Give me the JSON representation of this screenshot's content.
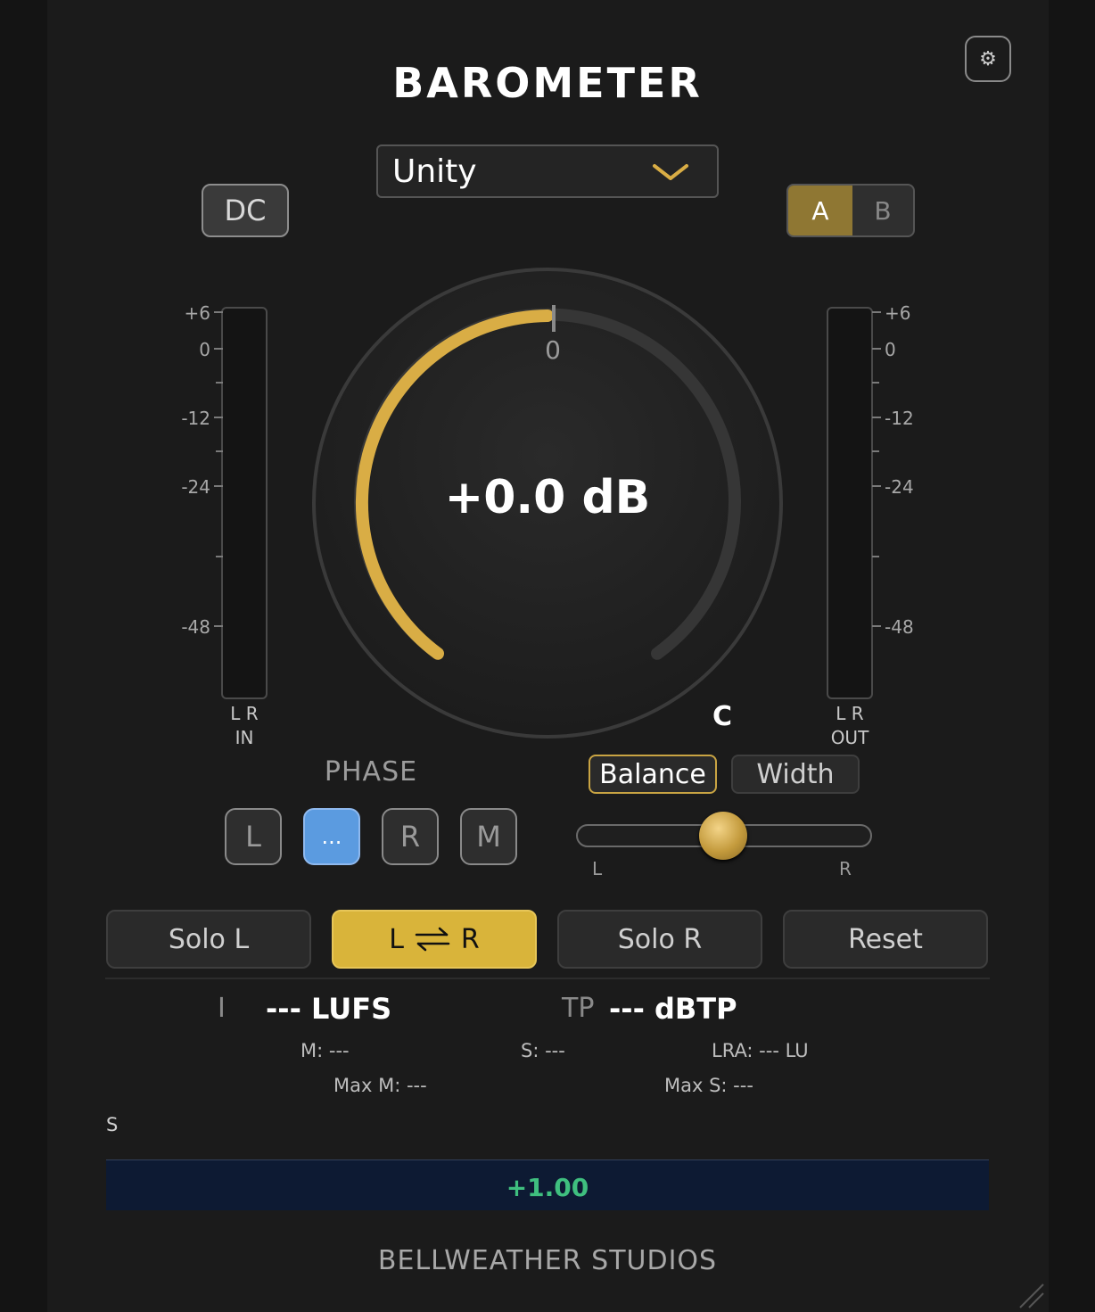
{
  "app": {
    "title": "BAROMETER",
    "footer": "BELLWEATHER STUDIOS"
  },
  "settings": {
    "icon": "gear-icon"
  },
  "preset": {
    "value": "Unity",
    "icon": "chevron-down-icon"
  },
  "dc_button": {
    "label": "DC"
  },
  "ab": {
    "a_label": "A",
    "b_label": "B",
    "selected": "A"
  },
  "input_meter": {
    "ticks": [
      "+6",
      "0",
      "-12",
      "-24",
      "-48"
    ],
    "channels": "L  R",
    "label": "IN"
  },
  "output_meter": {
    "ticks": [
      "+6",
      "0",
      "-12",
      "-24",
      "-48"
    ],
    "channels": "L  R",
    "label": "OUT"
  },
  "knob": {
    "value": "+0.0 dB",
    "zero_label": "0",
    "fill_fraction": 0.5,
    "accent": "#d9ad45"
  },
  "c_label": "C",
  "phase": {
    "title": "PHASE",
    "buttons": [
      {
        "label": "L",
        "active": false
      },
      {
        "label": "...",
        "active": true
      },
      {
        "label": "R",
        "active": false
      },
      {
        "label": "M",
        "active": false
      }
    ]
  },
  "stereo": {
    "balance_label": "Balance",
    "width_label": "Width",
    "selected": "Balance",
    "slider_left": "L",
    "slider_right": "R",
    "slider_value": 0.5
  },
  "actions": {
    "solo_l": "Solo L",
    "swap_left": "L",
    "swap_right": "R",
    "solo_r": "Solo R",
    "reset": "Reset"
  },
  "loudness": {
    "i_label": "I",
    "lufs_value": "--- LUFS",
    "tp_label": "TP",
    "dbtp_value": "--- dBTP",
    "m": "M: ---",
    "s": "S: ---",
    "lra": "LRA: --- LU",
    "max_m": "Max M: ---",
    "max_s": "Max S: ---",
    "s_axis": "S",
    "graph_value": "+1.00"
  },
  "colors": {
    "accent": "#d9b43a",
    "phase_active": "#5b9be0",
    "graph_value": "#3fbf7f"
  }
}
